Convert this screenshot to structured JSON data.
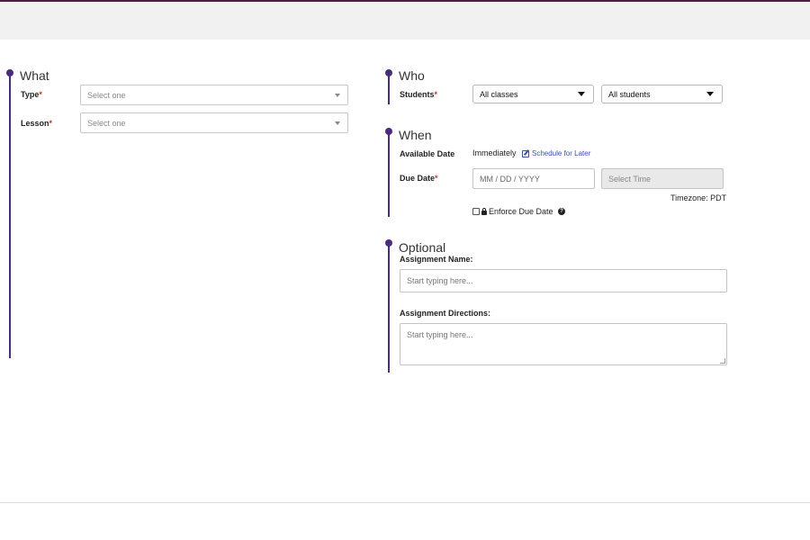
{
  "what": {
    "title": "What",
    "type_label": "Type",
    "type_placeholder": "Select one",
    "lesson_label": "Lesson",
    "lesson_placeholder": "Select one",
    "required_mark": "*"
  },
  "who": {
    "title": "Who",
    "students_label": "Students",
    "classes_value": "All classes",
    "students_value": "All students"
  },
  "when": {
    "title": "When",
    "available_label": "Available Date",
    "available_value": "Immediately",
    "schedule_link": "Schedule for Later",
    "due_label": "Due Date",
    "date_placeholder": "MM / DD / YYYY",
    "time_placeholder": "Select Time",
    "timezone": "Timezone: PDT",
    "enforce_label": "Enforce Due Date",
    "help_glyph": "?"
  },
  "optional": {
    "title": "Optional",
    "name_label": "Assignment Name:",
    "name_placeholder": "Start typing here...",
    "directions_label": "Assignment Directions:",
    "directions_placeholder": "Start typing here..."
  },
  "colors": {
    "accent": "#4a2c7d",
    "required": "#c0392b",
    "link": "#3a4fa8"
  },
  "icons": [
    "edit-icon",
    "lock-icon",
    "help-icon",
    "caret-down-icon"
  ]
}
